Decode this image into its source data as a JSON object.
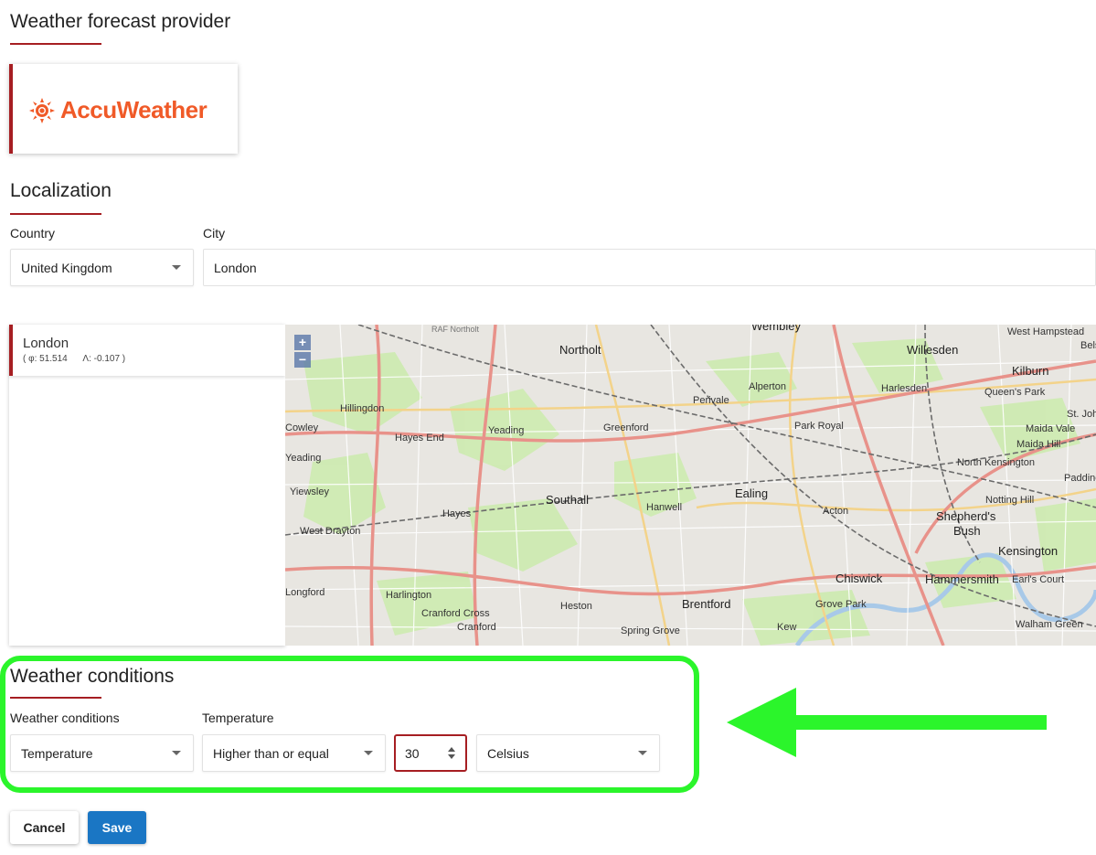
{
  "provider": {
    "title": "Weather forecast provider",
    "brand_name": "AccuWeather",
    "brand_color": "#f05a28",
    "accent_color": "#a61e22"
  },
  "localization": {
    "title": "Localization",
    "country_label": "Country",
    "country_value": "United Kingdom",
    "city_label": "City",
    "city_value": "London"
  },
  "location_list": {
    "items": [
      {
        "name": "London",
        "lat_text": "( φ: 51.514",
        "lon_text": "Λ: -0.107 )"
      }
    ]
  },
  "map": {
    "zoom_in": "+",
    "zoom_out": "−",
    "labels": [
      "RAF Northolt",
      "Northolt",
      "Wembley",
      "Willesden",
      "West Hampstead",
      "Belsize",
      "Kilburn",
      "Queen's Park",
      "Harlesden",
      "Alperton",
      "Perivale",
      "Hillingdon",
      "Yeading",
      "Greenford",
      "Park Royal",
      "Maida Vale",
      "St. John's",
      "Maida Hill",
      "Cowley",
      "Hayes End",
      "Yiewsley",
      "Yeading",
      "North Kensington",
      "Paddington",
      "Southall",
      "Hanwell",
      "Ealing",
      "Acton",
      "Notting Hill",
      "Shepherd's",
      "Bush",
      "Hayes",
      "West Drayton",
      "Kensington",
      "Chiswick",
      "Hammersmith",
      "Earl's Court",
      "Harlington",
      "Longford",
      "Cranford Cross",
      "Cranford",
      "Heston",
      "Brentford",
      "Grove Park",
      "Kew",
      "Spring Grove",
      "Walham Green"
    ]
  },
  "conditions": {
    "title": "Weather conditions",
    "condition_label": "Weather conditions",
    "condition_value": "Temperature",
    "temperature_label": "Temperature",
    "comparator_value": "Higher than or equal",
    "threshold_value": "30",
    "unit_value": "Celsius"
  },
  "actions": {
    "cancel_label": "Cancel",
    "save_label": "Save"
  },
  "annotation": {
    "highlight_color": "#2bf52b"
  }
}
